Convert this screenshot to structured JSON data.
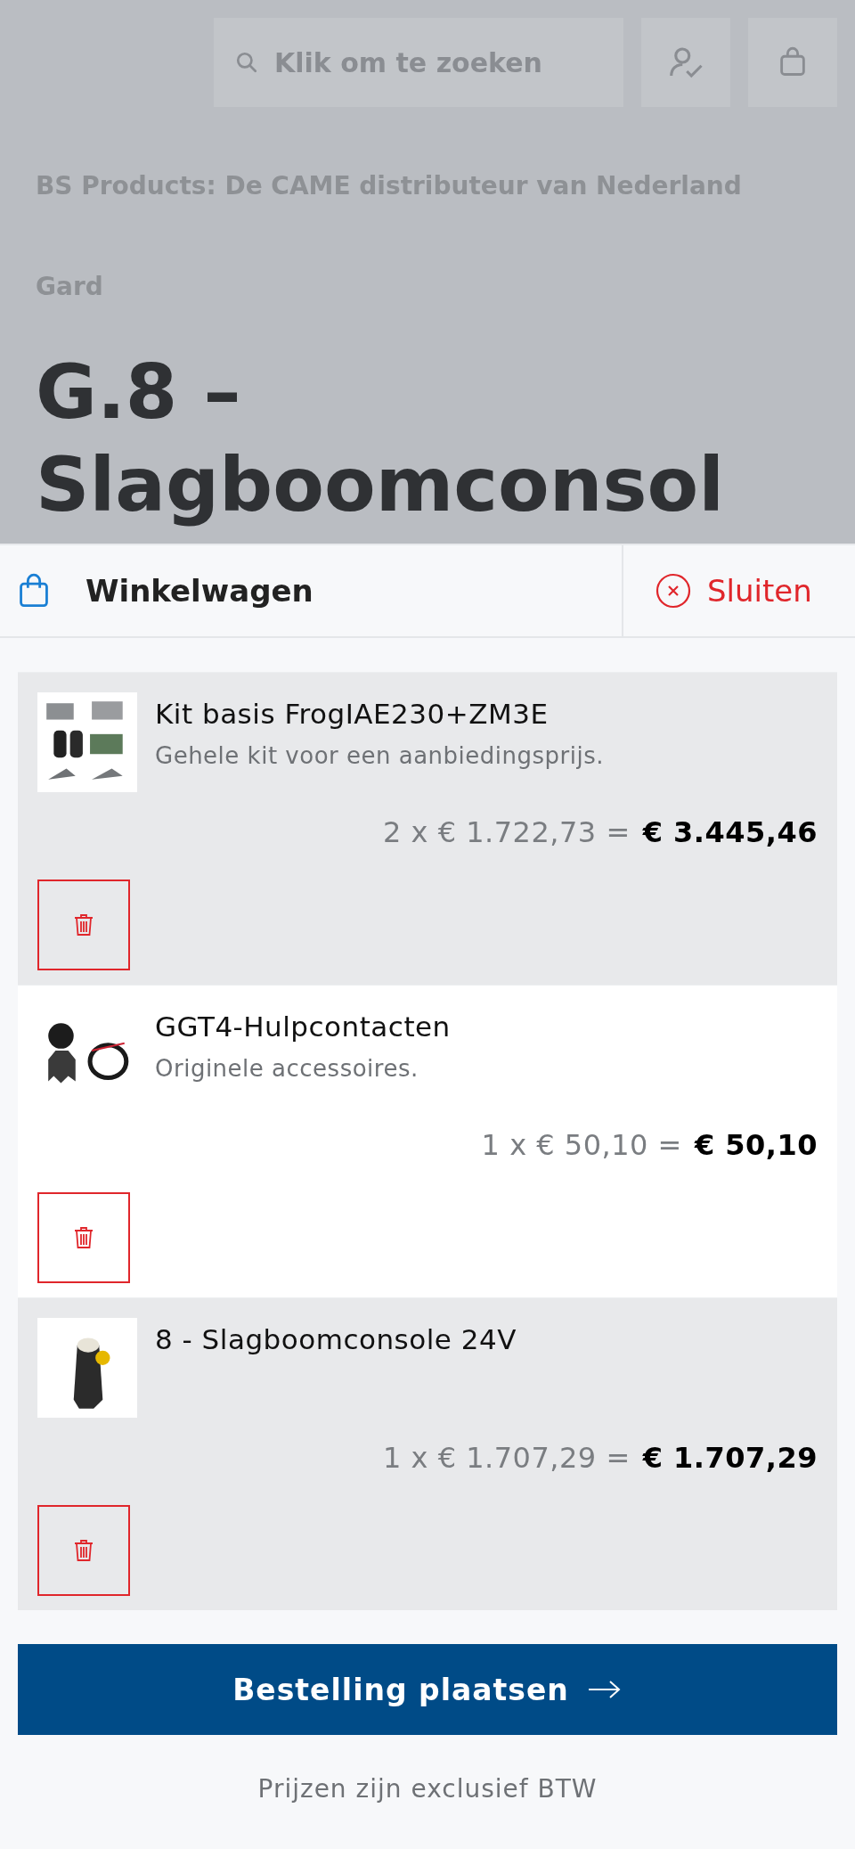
{
  "page": {
    "search": {
      "placeholder": "Klik om te zoeken"
    },
    "tagline": "BS Products: De CAME distributeur van Nederland",
    "breadcrumb": "Gard",
    "heading_lines": [
      "G.8 –",
      "Slagboomconsol"
    ]
  },
  "cart": {
    "title": "Winkelwagen",
    "close_label": "Sluiten",
    "items": [
      {
        "name": "Kit basis FrogIAE230+ZM3E",
        "description": "Gehele kit voor een aanbiedingsprijs.",
        "calculation": "2 x € 1.722,73 =",
        "total": "€ 3.445,46",
        "kind": "picture"
      },
      {
        "name": "GGT4-Hulpcontacten",
        "description": "Originele accessoires.",
        "calculation": "1 x € 50,10 =",
        "total": "€ 50,10",
        "kind": "picture"
      },
      {
        "name": "8 - Slagboomconsole 24V",
        "calculation": "1 x € 1.707,29 =",
        "total": "€ 1.707,29",
        "kind": "picture"
      }
    ],
    "order_button": "Bestelling plaatsen",
    "footnote": "Prijzen zijn exclusief BTW"
  }
}
